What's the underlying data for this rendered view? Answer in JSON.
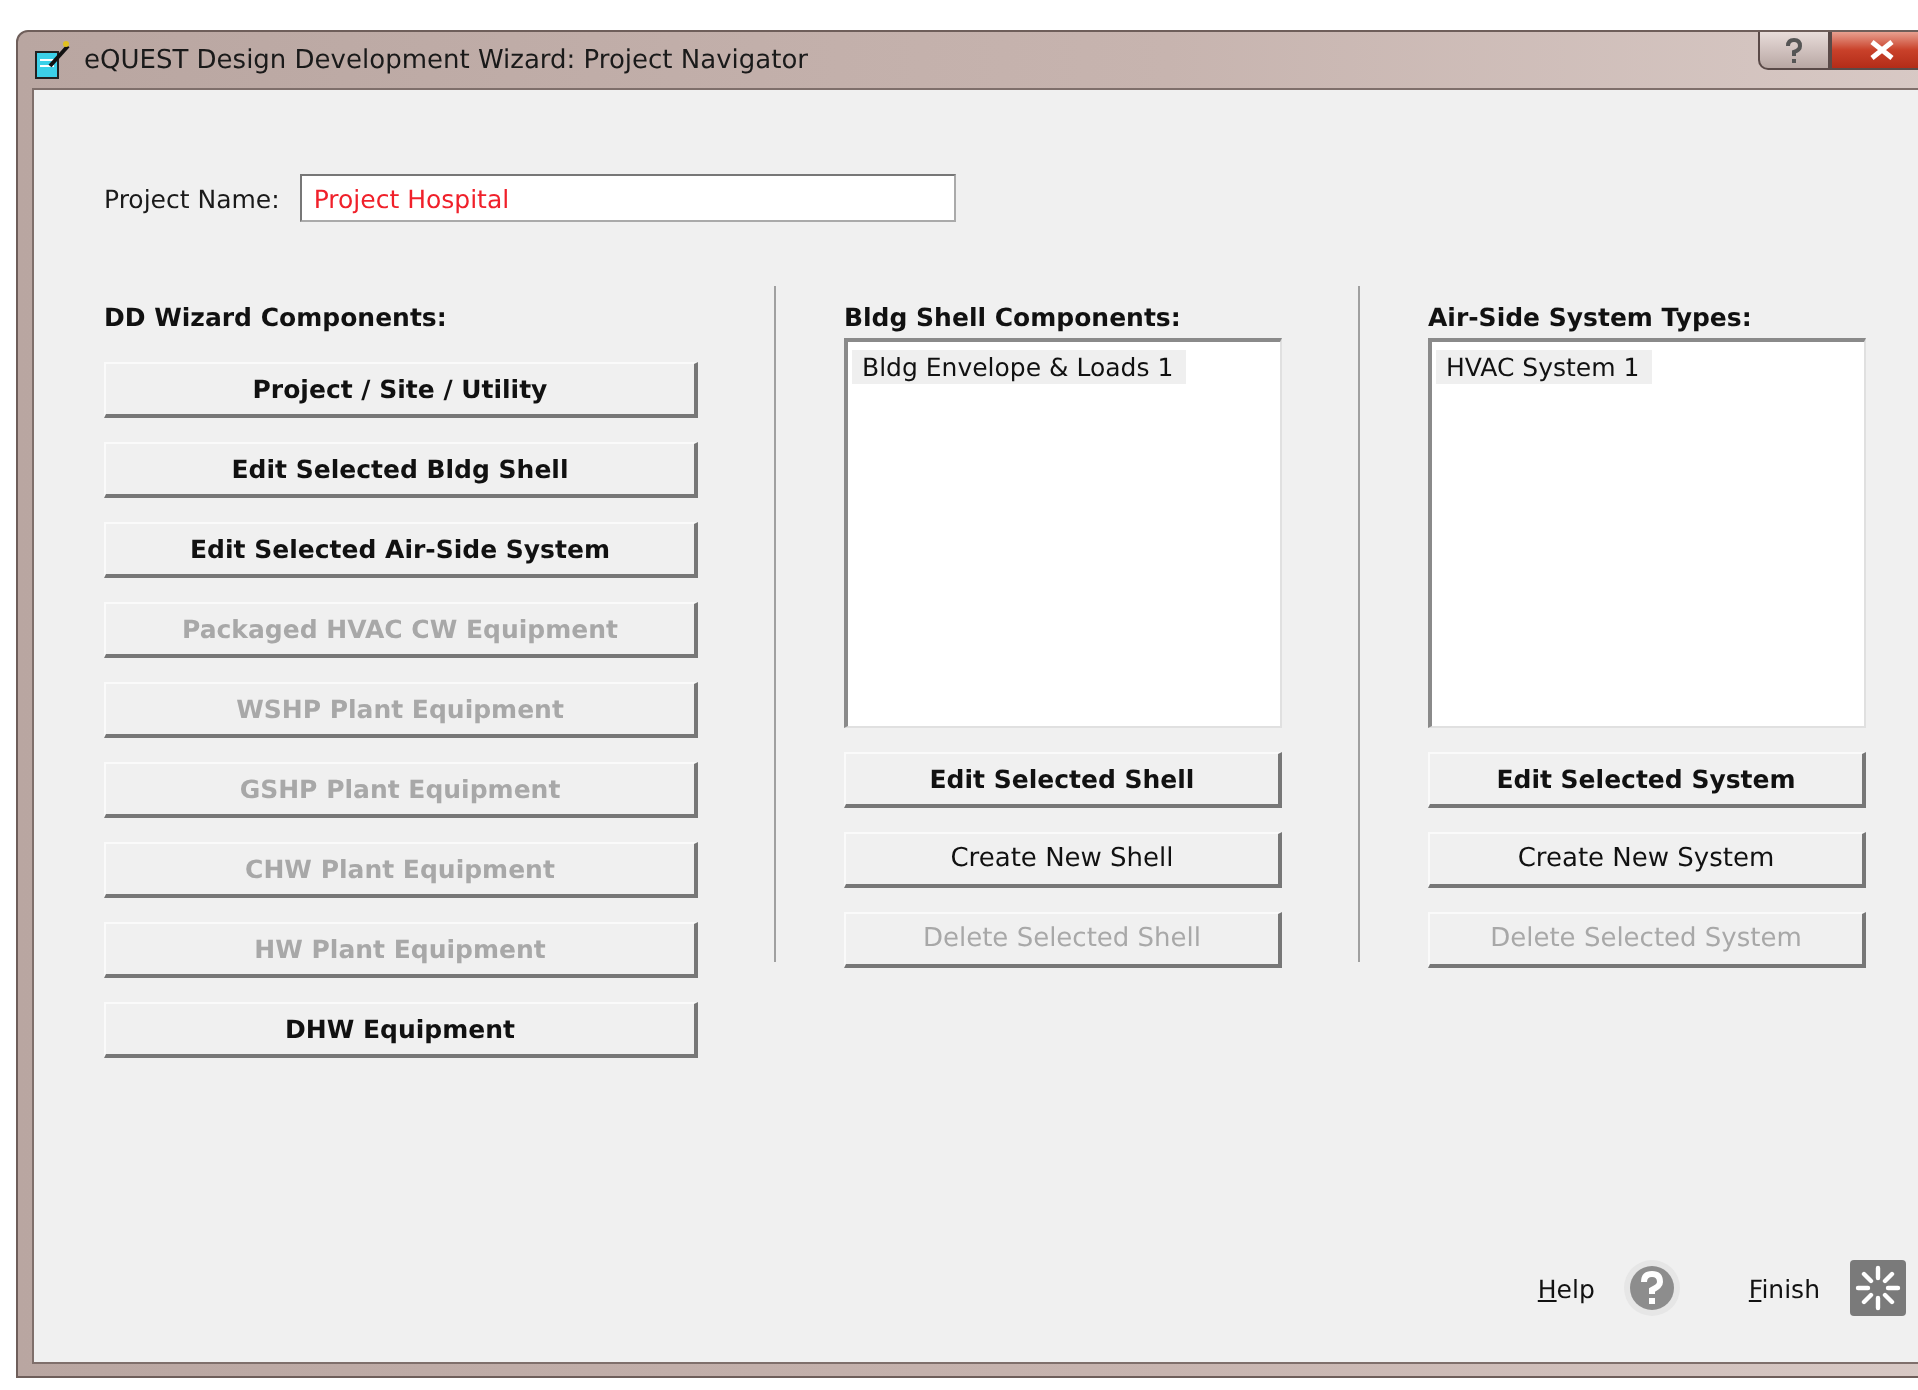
{
  "window": {
    "title": "eQUEST Design Development Wizard:  Project Navigator"
  },
  "project_name": {
    "label": "Project Name:",
    "value": "Project Hospital"
  },
  "dd_wizard": {
    "heading": "DD Wizard Components:",
    "buttons": [
      {
        "label": "Project / Site / Utility",
        "disabled": false
      },
      {
        "label": "Edit Selected Bldg Shell",
        "disabled": false
      },
      {
        "label": "Edit Selected Air-Side System",
        "disabled": false
      },
      {
        "label": "Packaged HVAC CW Equipment",
        "disabled": true
      },
      {
        "label": "WSHP Plant Equipment",
        "disabled": true
      },
      {
        "label": "GSHP Plant Equipment",
        "disabled": true
      },
      {
        "label": "CHW Plant Equipment",
        "disabled": true
      },
      {
        "label": "HW Plant Equipment",
        "disabled": true
      },
      {
        "label": "DHW Equipment",
        "disabled": false
      }
    ]
  },
  "lists": [
    {
      "heading": "Bldg Shell Components:",
      "items": [
        {
          "label": "Bldg Envelope & Loads 1",
          "selected": true
        }
      ],
      "buttons": [
        {
          "label": "Edit Selected Shell",
          "kind": "bold",
          "disabled": false
        },
        {
          "label": "Create New Shell",
          "kind": "plain",
          "disabled": false
        },
        {
          "label": "Delete Selected Shell",
          "kind": "plain",
          "disabled": true
        }
      ]
    },
    {
      "heading": "Air-Side System Types:",
      "items": [
        {
          "label": "HVAC System 1",
          "selected": true
        }
      ],
      "buttons": [
        {
          "label": "Edit Selected System",
          "kind": "bold",
          "disabled": false
        },
        {
          "label": "Create New System",
          "kind": "plain",
          "disabled": false
        },
        {
          "label": "Delete Selected System",
          "kind": "plain",
          "disabled": true
        }
      ]
    }
  ],
  "footer": {
    "help": "Help",
    "finish": "Finish"
  }
}
